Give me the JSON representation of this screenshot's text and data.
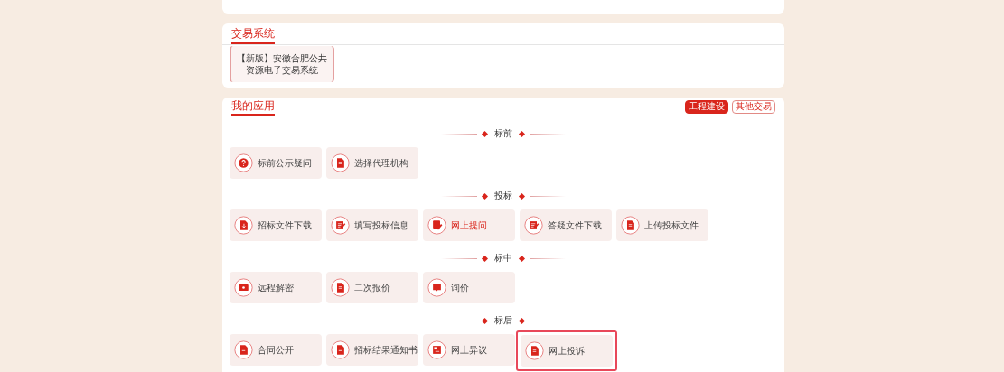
{
  "trade_system": {
    "title": "交易系统",
    "items": [
      {
        "line1": "【新版】安徽合肥公共",
        "line2": "资源电子交易系统",
        "selected": true
      }
    ]
  },
  "my_apps": {
    "title": "我的应用",
    "tabs": [
      {
        "label": "工程建设",
        "selected": true
      },
      {
        "label": "其他交易",
        "selected": false
      }
    ],
    "sections": [
      {
        "title": "标前",
        "items": [
          {
            "label": "标前公示疑问",
            "active": false,
            "highlighted": false
          },
          {
            "label": "选择代理机构",
            "active": false,
            "highlighted": false
          }
        ]
      },
      {
        "title": "投标",
        "items": [
          {
            "label": "招标文件下载",
            "active": false,
            "highlighted": false
          },
          {
            "label": "填写投标信息",
            "active": false,
            "highlighted": false
          },
          {
            "label": "网上提问",
            "active": true,
            "highlighted": false
          },
          {
            "label": "答疑文件下载",
            "active": false,
            "highlighted": false
          },
          {
            "label": "上传投标文件",
            "active": false,
            "highlighted": false
          }
        ]
      },
      {
        "title": "标中",
        "items": [
          {
            "label": "远程解密",
            "active": false,
            "highlighted": false
          },
          {
            "label": "二次报价",
            "active": false,
            "highlighted": false
          },
          {
            "label": "询价",
            "active": false,
            "highlighted": false
          }
        ]
      },
      {
        "title": "标后",
        "items": [
          {
            "label": "合同公开",
            "active": false,
            "highlighted": false
          },
          {
            "label": "招标结果通知书",
            "active": false,
            "highlighted": false
          },
          {
            "label": "网上异议",
            "active": false,
            "highlighted": false
          },
          {
            "label": "网上投诉",
            "active": false,
            "highlighted": true
          }
        ]
      }
    ]
  }
}
